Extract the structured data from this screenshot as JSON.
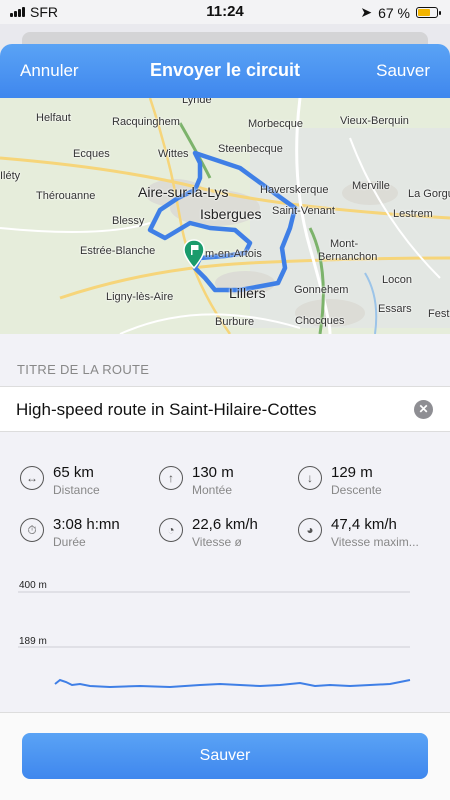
{
  "status_bar": {
    "carrier": "SFR",
    "time": "11:24",
    "battery": "67 %"
  },
  "nav": {
    "cancel": "Annuler",
    "title": "Envoyer le circuit",
    "save": "Sauver"
  },
  "map": {
    "towns": [
      "Lynde",
      "Helfaut",
      "Racquinghem",
      "Morbecque",
      "Vieux-Berquin",
      "Ecques",
      "Wittes",
      "Steenbecque",
      "Iléty",
      "Thérouanne",
      "Aire-sur-la-Lys",
      "Haverskerque",
      "Merville",
      "La Gorgu",
      "Isbergues",
      "Saint-Venant",
      "Lestrem",
      "Blessy",
      "Mont-",
      "Bernanchon",
      "Estrée-Blanche",
      "m-en-Artois",
      "Locon",
      "Ligny-lès-Aire",
      "Lillers",
      "Gonnehem",
      "Essars",
      "Burbure",
      "Chocques",
      "Fest"
    ]
  },
  "section": {
    "title_header": "TITRE DE LA ROUTE"
  },
  "route": {
    "title": "High-speed route in Saint-Hilaire-Cottes"
  },
  "stats": [
    {
      "icon": "distance-icon",
      "value": "65 km",
      "label": "Distance"
    },
    {
      "icon": "ascent-icon",
      "value": "130 m",
      "label": "Montée"
    },
    {
      "icon": "descent-icon",
      "value": "129 m",
      "label": "Descente"
    },
    {
      "icon": "duration-icon",
      "value": "3:08 h:mn",
      "label": "Durée"
    },
    {
      "icon": "avg-speed-icon",
      "value": "22,6 km/h",
      "label": "Vitesse ø"
    },
    {
      "icon": "max-speed-icon",
      "value": "47,4 km/h",
      "label": "Vitesse maxim..."
    }
  ],
  "elevation": {
    "max_label": "400 m",
    "ref_label": "189 m"
  },
  "bottom": {
    "save": "Sauver"
  },
  "colors": {
    "accent": "#4a90f0",
    "route": "#3f7fe6",
    "pin": "#1a9b6c"
  }
}
